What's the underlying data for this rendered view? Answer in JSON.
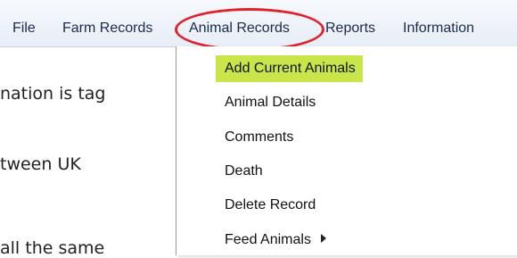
{
  "menubar": {
    "items": [
      {
        "label": "File"
      },
      {
        "label": "Farm Records"
      },
      {
        "label": "Animal Records"
      },
      {
        "label": "Reports"
      },
      {
        "label": "Information"
      }
    ]
  },
  "background_text": [
    "nation is tag",
    "tween UK",
    "all the same"
  ],
  "dropdown": {
    "items": [
      {
        "label": "Add Current Animals",
        "selected": true
      },
      {
        "label": "Animal Details"
      },
      {
        "label": "Comments"
      },
      {
        "label": "Death"
      },
      {
        "label": "Delete Record"
      },
      {
        "label": "Feed Animals",
        "has_submenu": true
      }
    ]
  },
  "colors": {
    "selected_highlight": "#c8e64a",
    "annotation_ellipse": "#e0222b"
  },
  "icons": {
    "submenu": "triangle-right-icon"
  }
}
